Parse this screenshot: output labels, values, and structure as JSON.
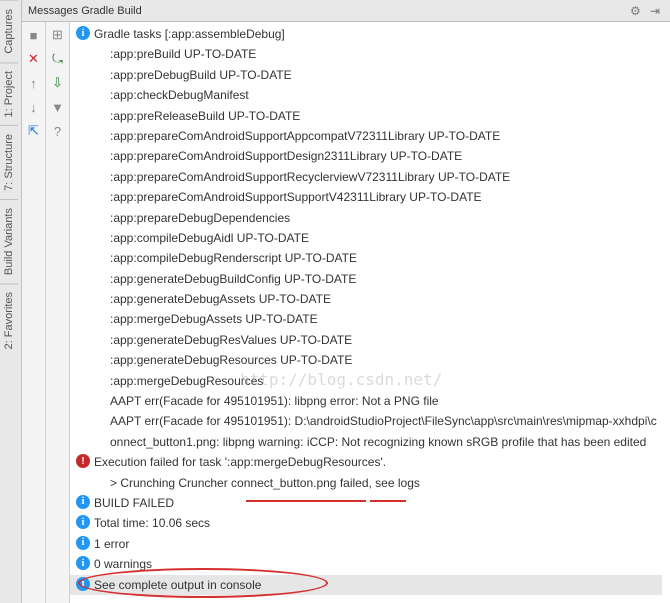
{
  "sideTabs": {
    "captures": "Captures",
    "project": "1: Project",
    "structure": "7: Structure",
    "buildVariants": "Build Variants",
    "favorites": "2: Favorites"
  },
  "panel": {
    "title": "Messages Gradle Build"
  },
  "toolbar": {
    "stop": "■",
    "close": "✕",
    "up": "↑",
    "down": "↓",
    "export": "⇱",
    "expand": "⊞",
    "filter": "▼",
    "help": "?"
  },
  "messages": [
    {
      "icon": "info",
      "indent": 0,
      "text": "Gradle tasks [:app:assembleDebug]"
    },
    {
      "icon": "",
      "indent": 1,
      "text": ":app:preBuild UP-TO-DATE"
    },
    {
      "icon": "",
      "indent": 1,
      "text": ":app:preDebugBuild UP-TO-DATE"
    },
    {
      "icon": "",
      "indent": 1,
      "text": ":app:checkDebugManifest"
    },
    {
      "icon": "",
      "indent": 1,
      "text": ":app:preReleaseBuild UP-TO-DATE"
    },
    {
      "icon": "",
      "indent": 1,
      "text": ":app:prepareComAndroidSupportAppcompatV72311Library UP-TO-DATE"
    },
    {
      "icon": "",
      "indent": 1,
      "text": ":app:prepareComAndroidSupportDesign2311Library UP-TO-DATE"
    },
    {
      "icon": "",
      "indent": 1,
      "text": ":app:prepareComAndroidSupportRecyclerviewV72311Library UP-TO-DATE"
    },
    {
      "icon": "",
      "indent": 1,
      "text": ":app:prepareComAndroidSupportSupportV42311Library UP-TO-DATE"
    },
    {
      "icon": "",
      "indent": 1,
      "text": ":app:prepareDebugDependencies"
    },
    {
      "icon": "",
      "indent": 1,
      "text": ":app:compileDebugAidl UP-TO-DATE"
    },
    {
      "icon": "",
      "indent": 1,
      "text": ":app:compileDebugRenderscript UP-TO-DATE"
    },
    {
      "icon": "",
      "indent": 1,
      "text": ":app:generateDebugBuildConfig UP-TO-DATE"
    },
    {
      "icon": "",
      "indent": 1,
      "text": ":app:generateDebugAssets UP-TO-DATE"
    },
    {
      "icon": "",
      "indent": 1,
      "text": ":app:mergeDebugAssets UP-TO-DATE"
    },
    {
      "icon": "",
      "indent": 1,
      "text": ":app:generateDebugResValues UP-TO-DATE"
    },
    {
      "icon": "",
      "indent": 1,
      "text": ":app:generateDebugResources UP-TO-DATE"
    },
    {
      "icon": "",
      "indent": 1,
      "text": ":app:mergeDebugResources"
    },
    {
      "icon": "",
      "indent": 1,
      "text": "AAPT err(Facade for 495101951): libpng error: Not a PNG file"
    },
    {
      "icon": "",
      "indent": 1,
      "text": "AAPT err(Facade for 495101951): D:\\androidStudioProject\\FileSync\\app\\src\\main\\res\\mipmap-xxhdpi\\connect_button1.png: libpng warning: iCCP: Not recognizing known sRGB profile that has been edited"
    },
    {
      "icon": "error",
      "indent": 0,
      "text": "Execution failed for task ':app:mergeDebugResources'."
    },
    {
      "icon": "",
      "indent": 1,
      "text": "> Crunching Cruncher connect_button.png failed, see logs"
    },
    {
      "icon": "info",
      "indent": 0,
      "text": "BUILD FAILED"
    },
    {
      "icon": "info",
      "indent": 0,
      "text": "Total time: 10.06 secs"
    },
    {
      "icon": "info",
      "indent": 0,
      "text": "1 error"
    },
    {
      "icon": "info",
      "indent": 0,
      "text": "0 warnings"
    },
    {
      "icon": "info",
      "indent": 0,
      "text": "See complete output in console",
      "highlighted": true
    }
  ],
  "watermark": "http://blog.csdn.net/"
}
